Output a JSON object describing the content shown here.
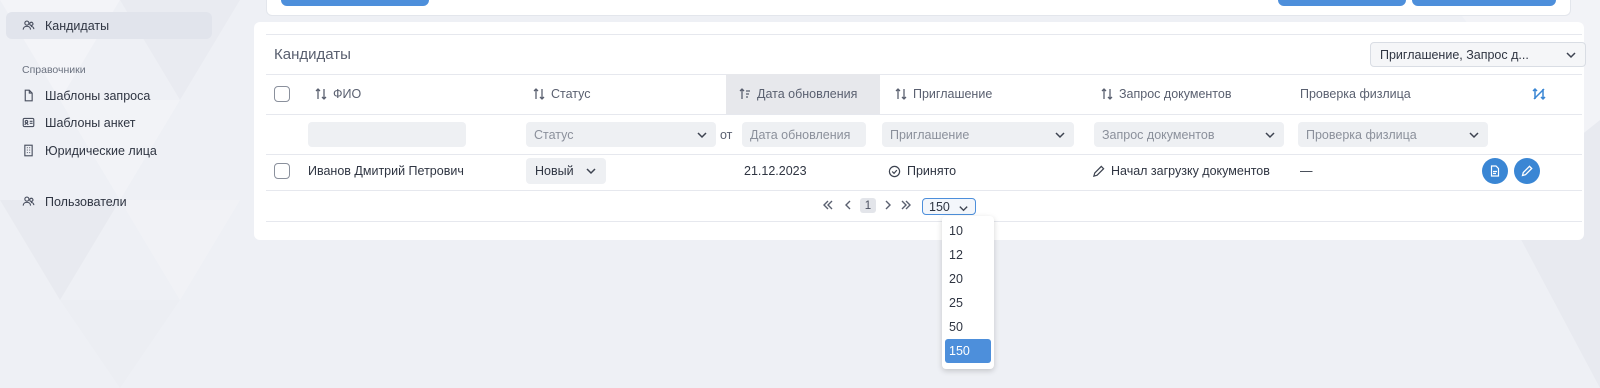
{
  "sidebar": {
    "items_top": [
      {
        "label": "Кандидаты",
        "icon": "users-icon",
        "active": true
      }
    ],
    "section_title": "Справочники",
    "reference_items": [
      {
        "label": "Шаблоны запроса",
        "icon": "file-icon"
      },
      {
        "label": "Шаблоны анкет",
        "icon": "id-card-icon"
      },
      {
        "label": "Юридические лица",
        "icon": "building-icon"
      }
    ],
    "users_item": {
      "label": "Пользователи",
      "icon": "users-icon"
    }
  },
  "card": {
    "title": "Кандидаты",
    "columns_select": "Приглашение, Запрос д..."
  },
  "table": {
    "headers": {
      "fio": "ФИО",
      "status": "Статус",
      "updated": "Дата обновления",
      "invitation": "Приглашение",
      "docs": "Запрос документов",
      "check": "Проверка физлица"
    },
    "filters": {
      "fio": "",
      "status": "Статус",
      "from_label": "от",
      "updated": "Дата обновления",
      "invitation": "Приглашение",
      "docs": "Запрос документов",
      "check": "Проверка физлица"
    },
    "rows": [
      {
        "fio": "Иванов Дмитрий Петрович",
        "status": "Новый",
        "updated": "21.12.2023",
        "invitation": "Принято",
        "docs": "Начал загрузку документов",
        "check": "—"
      }
    ]
  },
  "pagination": {
    "current_page": "1",
    "page_size": "150",
    "page_size_options": [
      "10",
      "12",
      "20",
      "25",
      "50",
      "150"
    ],
    "selected_option": "150"
  },
  "colors": {
    "accent": "#3a86d4",
    "background": "#eef0f5"
  }
}
